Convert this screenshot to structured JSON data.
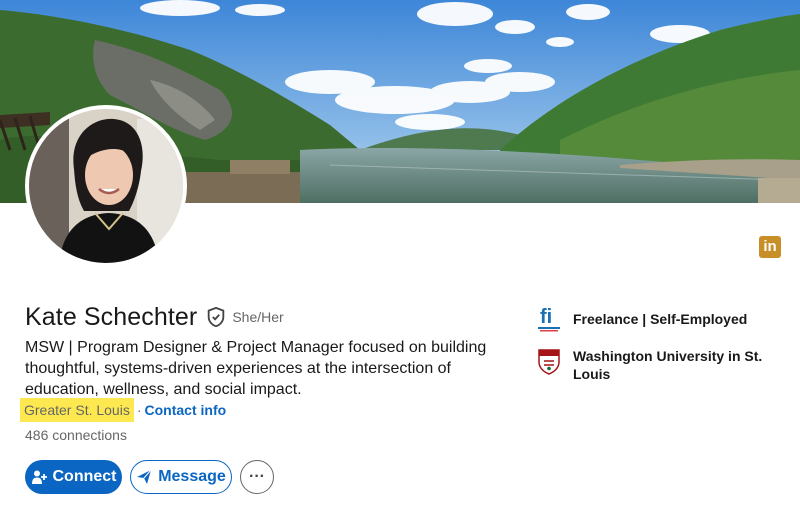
{
  "profile": {
    "name": "Kate Schechter",
    "pronouns": "She/Her",
    "headline": "MSW | Program Designer & Project Manager focused on building thoughtful, systems-driven experiences at the intersection of education, wellness, and social impact.",
    "location": "Greater St. Louis",
    "separator": "·",
    "contact_label": "Contact info",
    "connections_count": "486",
    "connections_label": "connections"
  },
  "actions": {
    "connect_label": "Connect",
    "message_label": "Message",
    "more_label": "···"
  },
  "badge": {
    "label": "in",
    "color": "#c88f29"
  },
  "experience": [
    {
      "name": "Freelance | Self-Employed",
      "logo_text": "fi",
      "icon": "freelance-logo-icon"
    },
    {
      "name": "Washington University in St. Louis",
      "icon": "university-shield-icon"
    }
  ],
  "colors": {
    "accent": "#0a66c2",
    "highlight": "#fde94f",
    "muted_text": "#666666"
  },
  "icons": {
    "verify": "verified-shield-icon",
    "connect": "add-person-icon",
    "message": "send-icon",
    "more": "ellipsis-icon"
  }
}
